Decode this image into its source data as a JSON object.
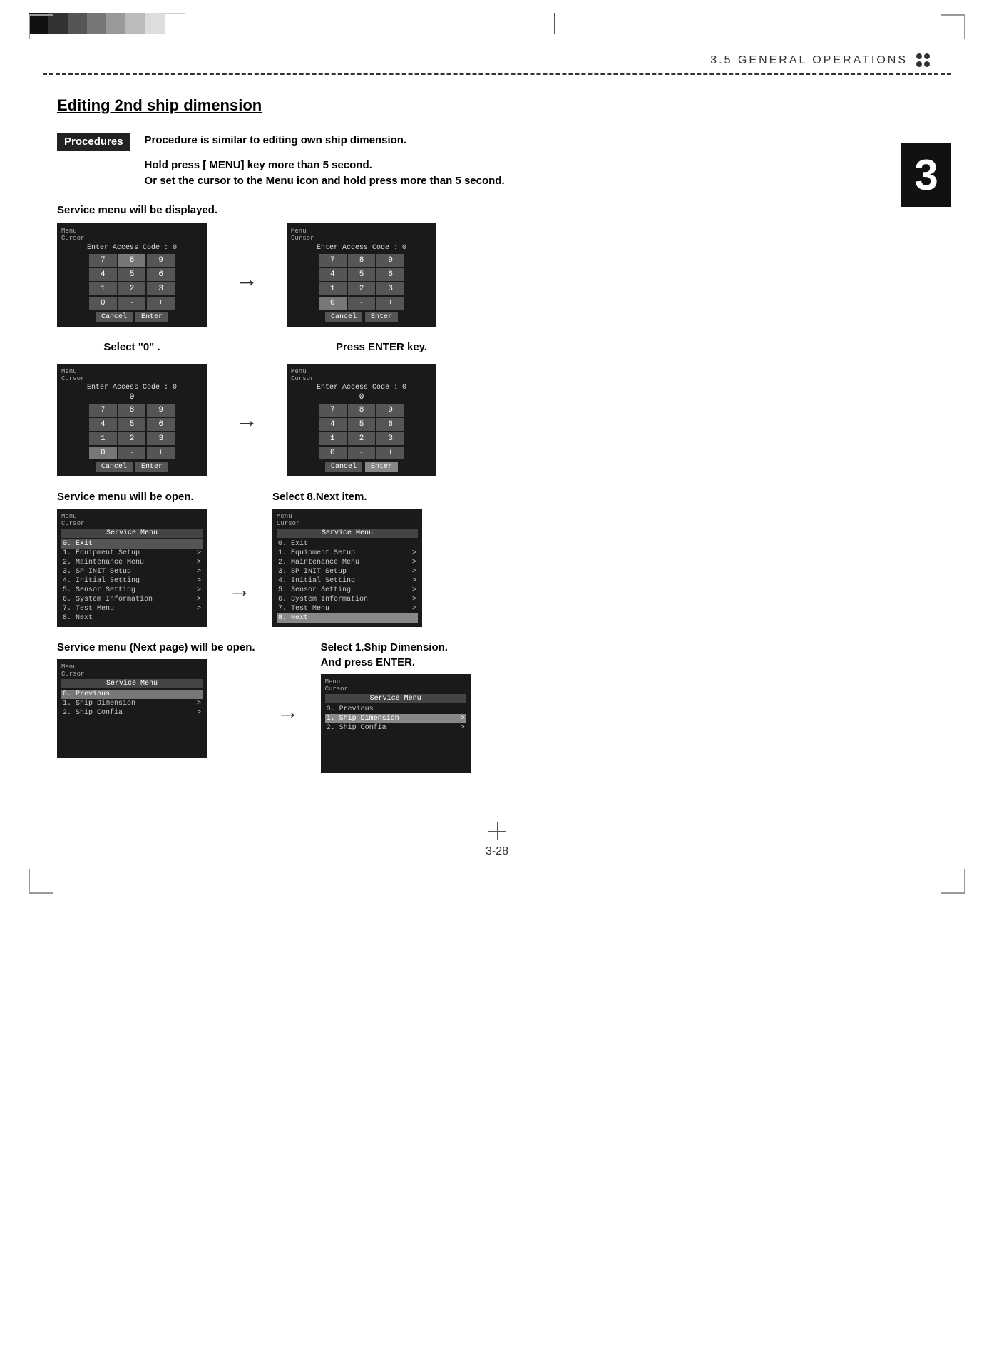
{
  "header": {
    "section": "3.5   GENERAL OPERATIONS",
    "colors": [
      "#111111",
      "#333333",
      "#555555",
      "#777777",
      "#999999",
      "#bbbbbb",
      "#dddddd",
      "#ffffff"
    ]
  },
  "page_title": "Editing 2nd ship dimension",
  "procedures_label": "Procedures",
  "procedure_text_line1": "Procedure is similar to editing own ship dimension.",
  "instruction_line1": "Hold press [ MENU] key more than 5 second.",
  "instruction_line2": "Or set the cursor to the Menu icon and hold press more than 5 second.",
  "service_menu_display": "Service menu will be displayed.",
  "select_zero": "Select  \"0\" .",
  "press_enter": "Press ENTER key.",
  "service_menu_open": "Service menu will be open.",
  "select_8next": "Select   8.Next item.",
  "next_page_open": "Service menu (Next page) will be open.",
  "select_ship_dim": "Select   1.Ship Dimension.",
  "and_press_enter": "And   press   ENTER.",
  "chapter_number": "3",
  "page_number": "3-28",
  "screen1": {
    "menu": "Menu",
    "cursor": "Cursor",
    "access_code": "Enter Access Code : 0",
    "numpad": [
      "7",
      "8",
      "9",
      "4",
      "5",
      "6",
      "1",
      "2",
      "3",
      "0",
      "-",
      "+"
    ],
    "buttons": [
      "Cancel",
      "Enter"
    ],
    "highlighted": "8"
  },
  "screen2": {
    "menu": "Menu",
    "cursor": "Cursor",
    "access_code": "Enter Access Code : 0",
    "numpad": [
      "7",
      "8",
      "9",
      "4",
      "5",
      "6",
      "1",
      "2",
      "3",
      "0",
      "-",
      "+"
    ],
    "buttons": [
      "Cancel",
      "Enter"
    ],
    "highlighted": "0"
  },
  "screen3": {
    "menu": "Menu",
    "cursor": "Cursor",
    "access_code": "Enter Access Code : 0",
    "selected_val": "0",
    "numpad": [
      "7",
      "8",
      "9",
      "4",
      "5",
      "6",
      "1",
      "2",
      "3"
    ],
    "bottom": [
      "0",
      "-",
      "+"
    ],
    "buttons": [
      "Cancel",
      "Enter"
    ],
    "highlighted": "0"
  },
  "screen4": {
    "menu": "Menu",
    "cursor": "Cursor",
    "access_code": "Enter Access Code : 0",
    "selected_val": "0",
    "numpad": [
      "7",
      "8",
      "9",
      "4",
      "5",
      "6",
      "1",
      "2",
      "3"
    ],
    "bottom": [
      "0",
      "-",
      "+"
    ],
    "buttons": [
      "Cancel",
      "Enter"
    ],
    "highlighted": "Enter"
  },
  "service_screen1": {
    "menu": "Menu",
    "cursor": "Cursor",
    "title": "Service Menu",
    "items": [
      {
        "num": "0",
        "label": "Exit",
        "arrow": "",
        "highlighted": false
      },
      {
        "num": "1",
        "label": "Equipment Setup",
        "arrow": ">",
        "highlighted": false
      },
      {
        "num": "2",
        "label": "Maintenance Menu",
        "arrow": ">",
        "highlighted": false
      },
      {
        "num": "3",
        "label": "SP INIT Setup",
        "arrow": ">",
        "highlighted": false
      },
      {
        "num": "4",
        "label": "Initial Setting",
        "arrow": ">",
        "highlighted": false
      },
      {
        "num": "5",
        "label": "Sensor Setting",
        "arrow": ">",
        "highlighted": false
      },
      {
        "num": "6",
        "label": "System Information",
        "arrow": ">",
        "highlighted": false
      },
      {
        "num": "7",
        "label": "Test Menu",
        "arrow": ">",
        "highlighted": false
      },
      {
        "num": "8",
        "label": "Next",
        "arrow": "",
        "highlighted": false
      }
    ]
  },
  "service_screen2": {
    "menu": "Menu",
    "cursor": "Cursor",
    "title": "Service Menu",
    "items": [
      {
        "num": "0",
        "label": "Exit",
        "arrow": "",
        "highlighted": false
      },
      {
        "num": "1",
        "label": "Equipment Setup",
        "arrow": ">",
        "highlighted": false
      },
      {
        "num": "2",
        "label": "Maintenance Menu",
        "arrow": ">",
        "highlighted": false
      },
      {
        "num": "3",
        "label": "SP INIT Setup",
        "arrow": ">",
        "highlighted": false
      },
      {
        "num": "4",
        "label": "Initial Setting",
        "arrow": ">",
        "highlighted": false
      },
      {
        "num": "5",
        "label": "Sensor Setting",
        "arrow": ">",
        "highlighted": false
      },
      {
        "num": "6",
        "label": "System Information",
        "arrow": ">",
        "highlighted": false
      },
      {
        "num": "7",
        "label": "Test Menu",
        "arrow": ">",
        "highlighted": false
      },
      {
        "num": "8",
        "label": "Next",
        "arrow": "",
        "highlighted": true
      }
    ]
  },
  "next_page_screen1": {
    "menu": "Menu",
    "cursor": "Cursor",
    "title": "Service Menu",
    "items": [
      {
        "num": "0",
        "label": "Previous",
        "arrow": "",
        "highlighted": true
      },
      {
        "num": "1",
        "label": "Ship Dimension",
        "arrow": ">",
        "highlighted": false
      },
      {
        "num": "2",
        "label": "Ship Confia",
        "arrow": ">",
        "highlighted": false
      }
    ]
  },
  "next_page_screen2": {
    "menu": "Menu",
    "cursor": "Cursor",
    "title": "Service Menu",
    "items": [
      {
        "num": "0",
        "label": "Previous",
        "arrow": "",
        "highlighted": false
      },
      {
        "num": "1",
        "label": "Ship Dimension",
        "arrow": ">",
        "highlighted": true
      },
      {
        "num": "2",
        "label": "Ship Confia",
        "arrow": ">",
        "highlighted": false
      }
    ]
  }
}
